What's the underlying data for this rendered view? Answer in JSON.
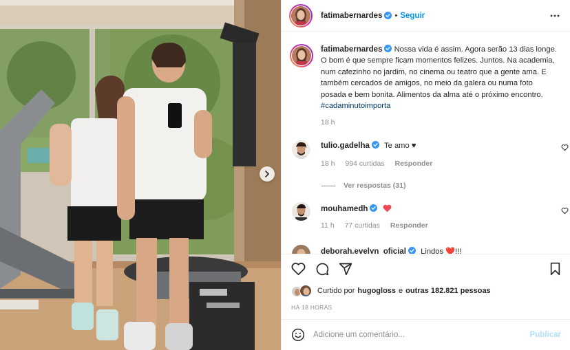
{
  "post": {
    "author": {
      "username": "fatimabernardes",
      "verified": true,
      "follow_label": "Seguir",
      "more_icon": "more-horizontal-icon"
    },
    "caption": {
      "username": "fatimabernardes",
      "lines": [
        "Nossa vida é assim. Agora serão 13 dias longe.",
        "O bom é que sempre ficam momentos felizes. Juntos. Na academia,",
        "num cafezinho no jardim, no cinema ou teatro que a gente ama. E",
        "também cercados de amigos, no meio da galera ou numa foto",
        "posada e bem bonita. Alimentos da alma até o próximo encontro."
      ],
      "hashtag": "#cadaminutoimporta",
      "time": "18 h"
    },
    "comments": [
      {
        "username": "tulio.gadelha",
        "verified": true,
        "text": "Te amo ♥",
        "time": "18 h",
        "likes": "994 curtidas",
        "reply_label": "Responder",
        "view_replies": "Ver respostas (31)"
      },
      {
        "username": "mouhamedh",
        "verified": true,
        "text": "",
        "emoji": "red-heart",
        "time": "11 h",
        "likes": "77 curtidas",
        "reply_label": "Responder"
      },
      {
        "username": "deborah.evelyn_oficial",
        "verified": true,
        "text": "Lindos ❤️!!!"
      }
    ],
    "liked_by": {
      "prefix": "Curtido por",
      "user": "hugogloss",
      "connector": "e",
      "others": "outras 182.821 pessoas"
    },
    "time_ago": "HÁ 18 HORAS",
    "comment_box": {
      "placeholder": "Adicione um comentário...",
      "publish_label": "Publicar"
    },
    "photo": {
      "carousel_next_icon": "chevron-right-icon"
    }
  },
  "colors": {
    "link_blue": "#0095f6",
    "hashtag": "#00376b",
    "muted": "#8e8e8e",
    "publish_disabled": "#b2dffc",
    "verified_blue": "#3897f0",
    "heart_red": "#ed4956"
  }
}
